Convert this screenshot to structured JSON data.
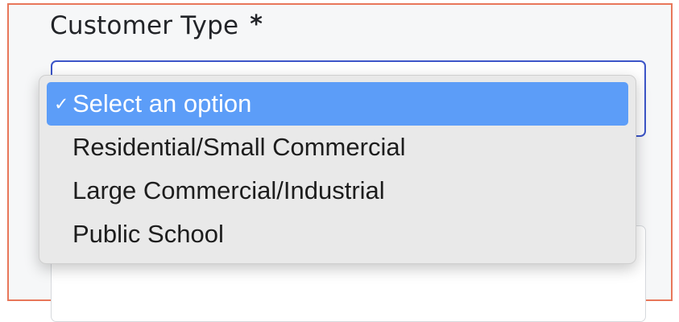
{
  "field": {
    "label": "Customer Type",
    "required_marker": "*"
  },
  "dropdown": {
    "selected_check": "✓",
    "options": [
      {
        "label": "Select an option",
        "selected": true
      },
      {
        "label": "Residential/Small Commercial",
        "selected": false
      },
      {
        "label": "Large Commercial/Industrial",
        "selected": false
      },
      {
        "label": "Public School",
        "selected": false
      }
    ]
  },
  "colors": {
    "frame_border": "#e8775a",
    "focus_border": "#3c55c8",
    "option_highlight": "#5c9df8"
  }
}
